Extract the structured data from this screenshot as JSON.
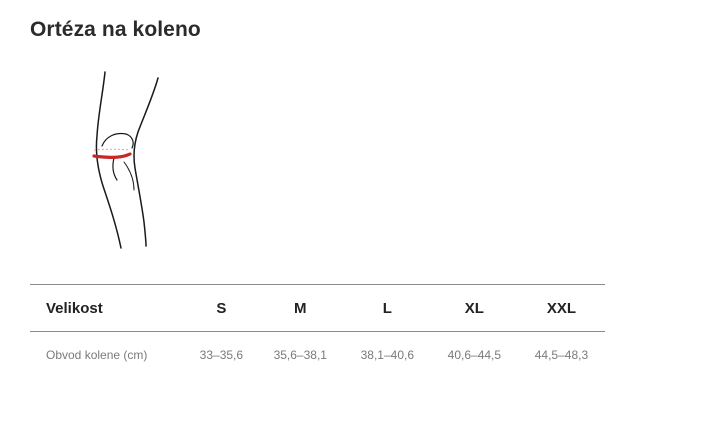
{
  "page": {
    "title": "Ortéza na koleno"
  },
  "illustration": {
    "icon": "knee-measurement-icon",
    "measure_color": "#c62828"
  },
  "size_table": {
    "header_label": "Velikost",
    "sizes": [
      "S",
      "M",
      "L",
      "XL",
      "XXL"
    ],
    "row_label": "Obvod kolene (cm)",
    "values": [
      "33–35,6",
      "35,6–38,1",
      "38,1–40,6",
      "40,6–44,5",
      "44,5–48,3"
    ]
  }
}
